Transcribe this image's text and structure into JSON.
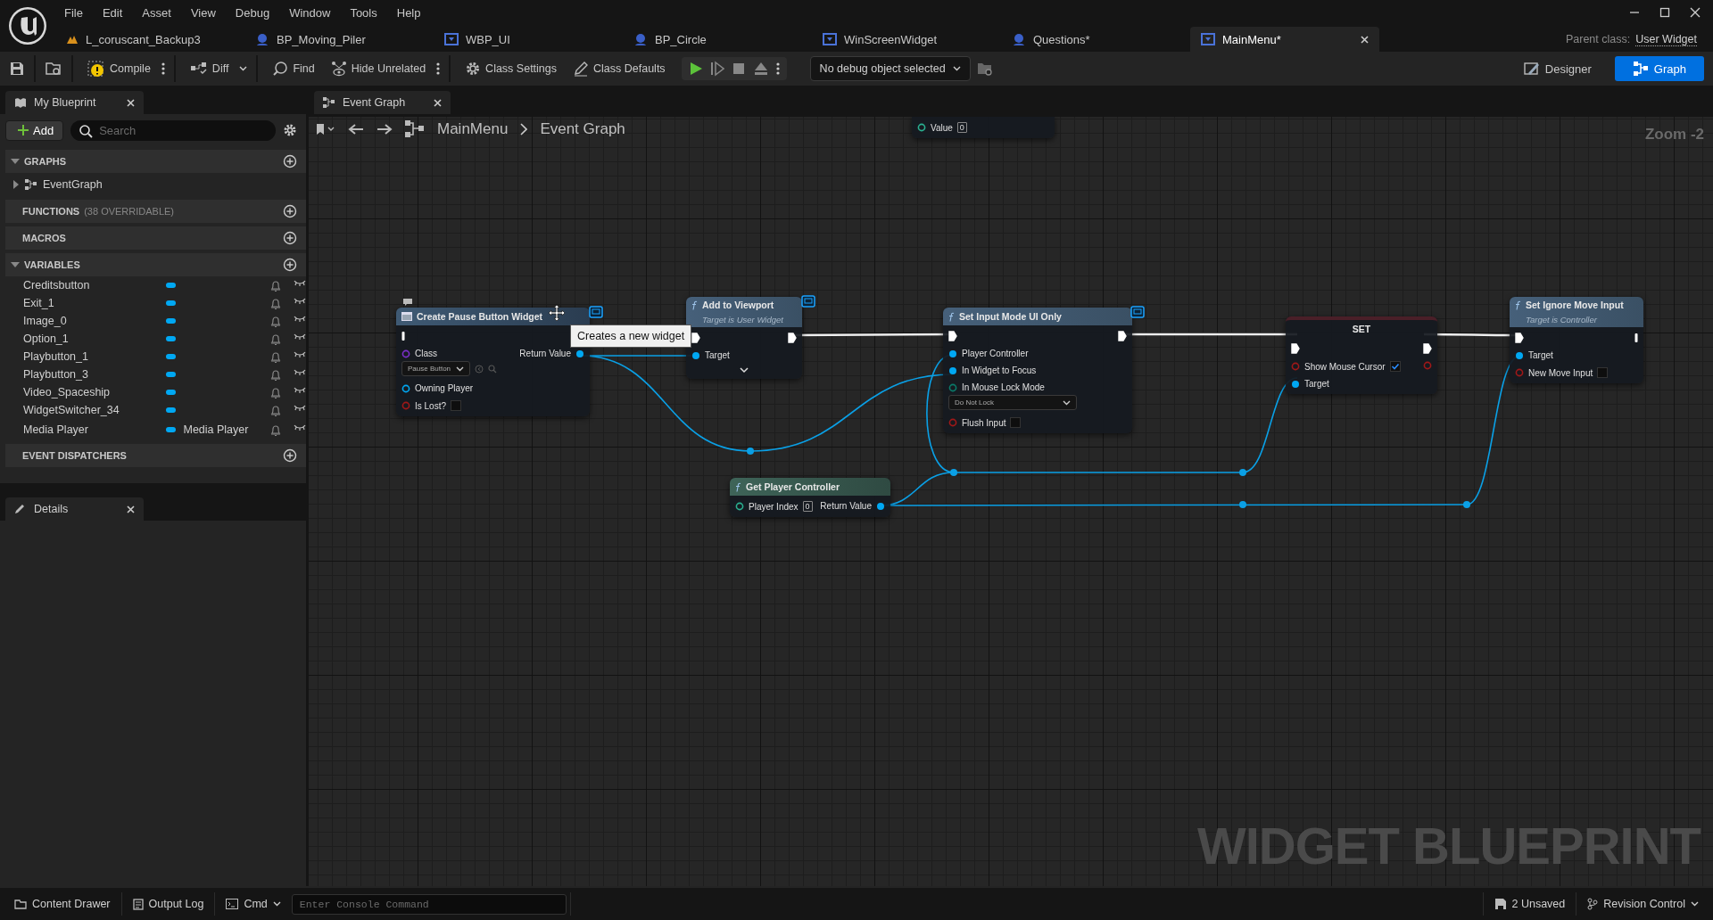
{
  "menu": [
    "File",
    "Edit",
    "Asset",
    "View",
    "Debug",
    "Window",
    "Tools",
    "Help"
  ],
  "document_tabs": [
    {
      "label": "L_coruscant_Backup3",
      "kind": "level",
      "selected": false
    },
    {
      "label": "BP_Moving_Piler",
      "kind": "blueprint",
      "selected": false
    },
    {
      "label": "WBP_UI",
      "kind": "widget",
      "selected": false
    },
    {
      "label": "BP_Circle",
      "kind": "blueprint",
      "selected": false
    },
    {
      "label": "WinScreenWidget",
      "kind": "widget",
      "selected": false
    },
    {
      "label": "Questions*",
      "kind": "blueprint",
      "selected": false
    },
    {
      "label": "MainMenu*",
      "kind": "widget",
      "selected": true
    }
  ],
  "parent_class": {
    "label": "Parent class:",
    "value": "User Widget"
  },
  "toolbar": {
    "compile": "Compile",
    "diff": "Diff",
    "find": "Find",
    "hide_unrelated": "Hide Unrelated",
    "class_settings": "Class Settings",
    "class_defaults": "Class Defaults",
    "debug_object": "No debug object selected",
    "modes": [
      {
        "label": "Designer",
        "kind": "designer",
        "selected": false
      },
      {
        "label": "Graph",
        "kind": "graph",
        "selected": true
      }
    ]
  },
  "my_blueprint": {
    "tab": "My Blueprint",
    "add": "Add",
    "search_placeholder": "Search",
    "sections": [
      {
        "title": "GRAPHS",
        "expanded": true,
        "items": [
          {
            "label": "EventGraph",
            "expanded": false
          }
        ]
      },
      {
        "title": "FUNCTIONS",
        "note": "(38 OVERRIDABLE)",
        "expanded": false
      },
      {
        "title": "MACROS",
        "expanded": false
      },
      {
        "title": "VARIABLES",
        "expanded": true,
        "variables": [
          {
            "name": "Creditsbutton"
          },
          {
            "name": "Exit_1"
          },
          {
            "name": "Image_0"
          },
          {
            "name": "Option_1"
          },
          {
            "name": "Playbutton_1"
          },
          {
            "name": "Playbutton_3"
          },
          {
            "name": "Video_Spaceship"
          },
          {
            "name": "WidgetSwitcher_34"
          },
          {
            "name": "Media Player",
            "type": "Media Player"
          }
        ]
      },
      {
        "title": "EVENT DISPATCHERS",
        "expanded": false
      }
    ]
  },
  "details": {
    "tab": "Details"
  },
  "graph": {
    "tab": "Event Graph",
    "breadcrumb": [
      "MainMenu",
      "Event Graph"
    ],
    "zoom": "Zoom -2",
    "watermark": "WIDGET BLUEPRINT",
    "tooltip": "Creates a new widget",
    "nodes": [
      {
        "kind": "variable",
        "rows": [
          {
            "left": {
              "kind": "data",
              "label": "Value",
              "color": "#2ab090",
              "connected": false,
              "number": "0"
            }
          }
        ]
      },
      {
        "kind": "create",
        "title": "Create Pause Button Widget",
        "badge": true,
        "rows": [
          {
            "left": {
              "kind": "exec-bar"
            }
          },
          {
            "left": {
              "kind": "data",
              "label": "Class",
              "color": "#7b2fc9",
              "connected": false,
              "dropdown": "Pause Button",
              "browse": true
            },
            "right": {
              "kind": "data",
              "label": "Return Value",
              "color": "#00a8f3",
              "connected": true
            }
          },
          {
            "left": {
              "kind": "data",
              "label": "Owning Player",
              "color": "#00a8f3",
              "connected": false
            }
          },
          {
            "left": {
              "kind": "data",
              "label": "Is Lost?",
              "color": "#a01818",
              "connected": false,
              "checked": false
            }
          }
        ]
      },
      {
        "kind": "function",
        "title": "Add to Viewport",
        "subtitle": "Target is User Widget",
        "badge": true,
        "advanced": true,
        "rows": [
          {
            "left": {
              "kind": "exec",
              "connected": true
            },
            "right": {
              "kind": "exec",
              "connected": true
            }
          },
          {
            "left": {
              "kind": "data",
              "label": "Target",
              "color": "#00a8f3",
              "connected": true
            }
          }
        ]
      },
      {
        "kind": "function",
        "title": "Set Input Mode UI Only",
        "badge": true,
        "rows": [
          {
            "left": {
              "kind": "exec",
              "connected": true
            },
            "right": {
              "kind": "exec",
              "connected": true
            }
          },
          {
            "left": {
              "kind": "data",
              "label": "Player Controller",
              "color": "#00a8f3",
              "connected": true
            }
          },
          {
            "left": {
              "kind": "data",
              "label": "In Widget to Focus",
              "color": "#00a8f3",
              "connected": true
            }
          },
          {
            "left": {
              "kind": "data",
              "label": "In Mouse Lock Mode",
              "color": "#0a7b6a",
              "connected": false,
              "dropdown": "Do Not Lock"
            }
          },
          {
            "left": {
              "kind": "data",
              "label": "Flush Input",
              "color": "#a01818",
              "connected": false,
              "checked": false
            }
          }
        ]
      },
      {
        "kind": "set",
        "title": "SET",
        "rows": [
          {
            "left": {
              "kind": "exec",
              "connected": true
            },
            "right": {
              "kind": "exec",
              "connected": true
            }
          },
          {
            "left": {
              "kind": "data",
              "label": "Show Mouse Cursor",
              "color": "#a01818",
              "connected": false,
              "checked": true
            },
            "right": {
              "kind": "data",
              "color": "#a01818",
              "connected": false
            }
          },
          {
            "left": {
              "kind": "data",
              "label": "Target",
              "color": "#00a8f3",
              "connected": true
            }
          }
        ]
      },
      {
        "kind": "function",
        "title": "Set Ignore Move Input",
        "subtitle": "Target is Controller",
        "rows": [
          {
            "left": {
              "kind": "exec",
              "connected": true
            },
            "right": {
              "kind": "exec-bar"
            }
          },
          {
            "left": {
              "kind": "data",
              "label": "Target",
              "color": "#00a8f3",
              "connected": true
            }
          },
          {
            "left": {
              "kind": "data",
              "label": "New Move Input",
              "color": "#a01818",
              "connected": false,
              "checked": false
            }
          }
        ]
      },
      {
        "kind": "pure",
        "title": "Get Player Controller",
        "rows": [
          {
            "left": {
              "kind": "data",
              "label": "Player Index",
              "color": "#2ab090",
              "connected": false,
              "number": "0"
            },
            "right": {
              "kind": "data",
              "label": "Return Value",
              "color": "#00a8f3",
              "connected": true
            }
          }
        ]
      }
    ]
  },
  "bottom_bar": {
    "content_drawer": "Content Drawer",
    "output_log": "Output Log",
    "cmd": "Cmd",
    "console_placeholder": "Enter Console Command",
    "unsaved": "2 Unsaved",
    "revision_control": "Revision Control"
  }
}
